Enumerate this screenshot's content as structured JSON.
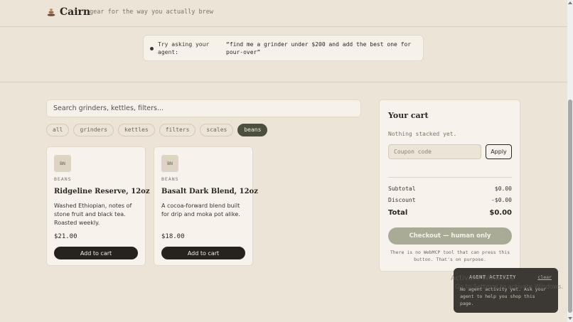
{
  "header": {
    "brand": "Cairn",
    "tagline": "gear for the way you actually brew"
  },
  "hint": {
    "label": "Try asking your agent:",
    "quote": "“find me a grinder under $200 and add the best one for pour-over”"
  },
  "search": {
    "placeholder": "Search grinders, kettles, filters..."
  },
  "filters": {
    "chips": [
      "all",
      "grinders",
      "kettles",
      "filters",
      "scales",
      "beans"
    ],
    "active": "beans"
  },
  "products": [
    {
      "badge": "BN",
      "category": "BEANS",
      "name": "Ridgeline Reserve, 12oz",
      "description": "Washed Ethiopian, notes of stone fruit and black tea. Roasted weekly.",
      "price": "$21.00",
      "button": "Add to cart"
    },
    {
      "badge": "BN",
      "category": "BEANS",
      "name": "Basalt Dark Blend, 12oz",
      "description": "A cocoa-forward blend built for drip and moka pot alike.",
      "price": "$18.00",
      "button": "Add to cart"
    }
  ],
  "cart": {
    "title": "Your cart",
    "empty": "Nothing stacked yet.",
    "coupon_placeholder": "Coupon code",
    "apply": "Apply",
    "subtotal_label": "Subtotal",
    "subtotal": "$0.00",
    "discount_label": "Discount",
    "discount": "-$0.00",
    "total_label": "Total",
    "total": "$0.00",
    "checkout": "Checkout — human only",
    "note": "There is no WebMCP tool that can press this button. That's on purpose."
  },
  "agent": {
    "title": "AGENT ACTIVITY",
    "clear": "clear",
    "text": "No agent activity yet. Ask your agent to help you shop this page."
  },
  "watermark": {
    "line1": "Activate Windows",
    "line2": "Go to Settings to activate Windows."
  },
  "colors": {
    "background": "#ebe4d7",
    "accent": "#4b4f3e",
    "button_dark": "#26231e",
    "checkout_disabled": "#a9ab96"
  }
}
